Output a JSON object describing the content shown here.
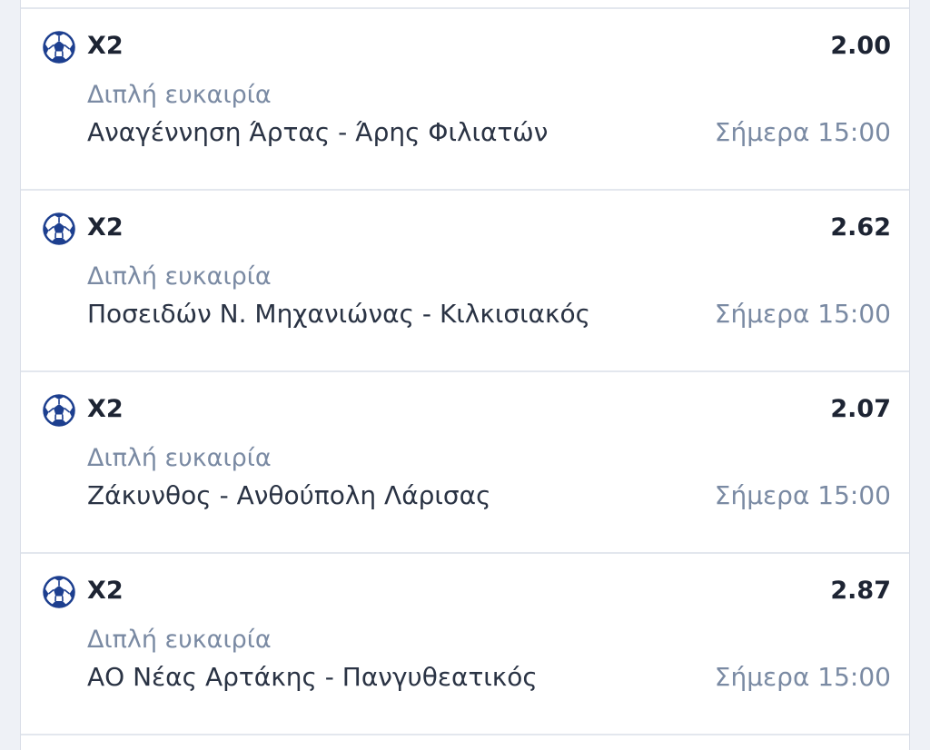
{
  "bets": [
    {
      "icon": "football-icon",
      "selection": "X2",
      "odds": "2.00",
      "market": "Διπλή ευκαιρία",
      "event": "Αναγέννηση Άρτας - Άρης Φιλιατών",
      "time": "Σήμερα 15:00"
    },
    {
      "icon": "football-icon",
      "selection": "X2",
      "odds": "2.62",
      "market": "Διπλή ευκαιρία",
      "event": "Ποσειδών Ν. Μηχανιώνας - Κιλκισιακός",
      "time": "Σήμερα 15:00"
    },
    {
      "icon": "football-icon",
      "selection": "X2",
      "odds": "2.07",
      "market": "Διπλή ευκαιρία",
      "event": "Ζάκυνθος - Ανθούπολη Λάρισας",
      "time": "Σήμερα 15:00"
    },
    {
      "icon": "football-icon",
      "selection": "X2",
      "odds": "2.87",
      "market": "Διπλή ευκαιρία",
      "event": "ΑΟ Νέας Αρτάκης - Πανγυθεατικός",
      "time": "Σήμερα 15:00"
    }
  ],
  "colors": {
    "primary_text": "#1d2433",
    "secondary_text": "#7a8aa3",
    "icon_blue": "#1d3f8f",
    "divider": "#e3e7ee"
  }
}
